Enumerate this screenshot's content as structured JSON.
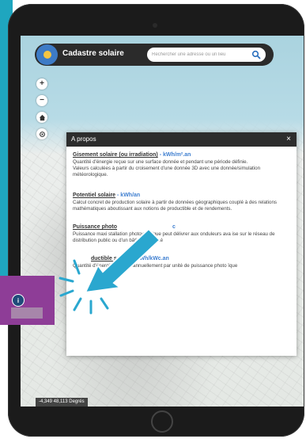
{
  "app": {
    "title": "Cadastre solaire",
    "search_placeholder": "Rechercher une adresse ou un lieu"
  },
  "map_controls": [
    {
      "name": "zoom-in",
      "symbol": "+"
    },
    {
      "name": "zoom-out",
      "symbol": "−"
    },
    {
      "name": "home-icon",
      "symbol": ""
    },
    {
      "name": "locate-icon",
      "symbol": ""
    }
  ],
  "dialog": {
    "title": "A propos",
    "close_symbol": "×",
    "sections": [
      {
        "name": "Gisement solaire (ou irradiation)",
        "unit": " - kWh/m².an",
        "text": "Quantité d'énergie reçue sur une surface donnée et pendant une période définie.\nValeurs calculées à partir du croisement d'une donnée 3D avec une donnée/simulation météorologique."
      },
      {
        "name": "Potentiel solaire",
        "unit": " - kWh/an",
        "text": "Calcul concret de production solaire à partir de données géographiques couplé à des relations mathématiques aboutissant aux      notions de productible et de rendements."
      },
      {
        "name": "Puissance photo",
        "unit": "c",
        "text": "Puissance maxi         stallation photovoltaïque peut délivrer aux onduleurs ava             ise sur le réseau de distribution public ou d'un bâtiment donné"
      },
      {
        "name": "ductible solaire",
        "unit": " - kWh/kWc.an",
        "text": "Quantité d'énergie produite annuellement par unité de puissance photo           ïque"
      }
    ]
  },
  "coordinates": "-4,349 48,113 Degrés",
  "colors": {
    "accent_teal": "#1fa6bf",
    "highlight_purple": "#8e3d97",
    "arrow_blue": "#2aa7cf",
    "unit_blue": "#3f7fd0",
    "header_dark": "#2d2d2d"
  },
  "icons": {
    "search": "search-icon",
    "info": "info-icon",
    "close": "close-icon",
    "home": "home-icon",
    "locate": "locate-icon"
  }
}
